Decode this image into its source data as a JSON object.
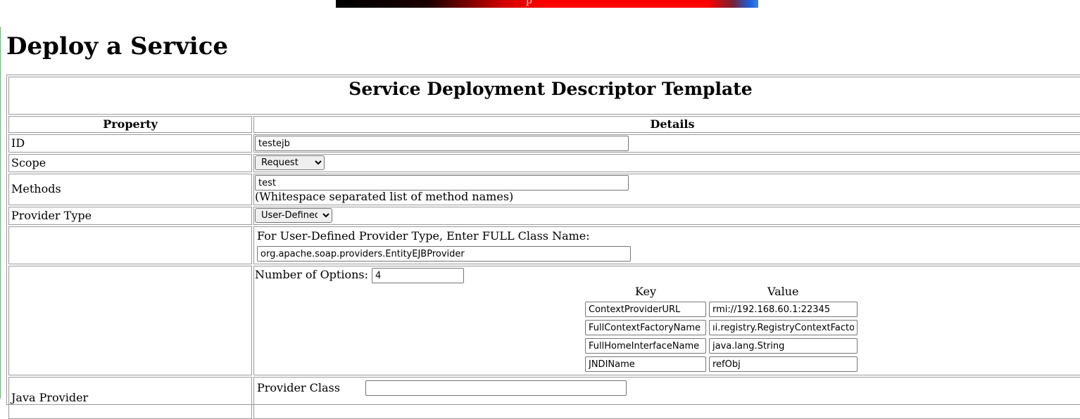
{
  "banner": {
    "glyph": "p"
  },
  "page": {
    "title": "Deploy a Service"
  },
  "form": {
    "table_title": "Service Deployment Descriptor Template",
    "columns": {
      "property": "Property",
      "details": "Details"
    },
    "id": {
      "label": "ID",
      "value": "testejb"
    },
    "scope": {
      "label": "Scope",
      "selected": "Request"
    },
    "methods": {
      "label": "Methods",
      "value": "test",
      "hint": "(Whitespace separated list of method names)"
    },
    "provider_type": {
      "label": "Provider Type",
      "selected": "User-Defined"
    },
    "user_defined": {
      "prompt": "For User-Defined Provider Type, Enter FULL Class Name:",
      "class_name": "org.apache.soap.providers.EntityEJBProvider"
    },
    "options": {
      "count_label": "Number of Options:",
      "count": "4",
      "key_header": "Key",
      "value_header": "Value",
      "rows": [
        {
          "key": "ContextProviderURL",
          "value": "rmi://192.168.60.1:22345"
        },
        {
          "key": "FullContextFactoryName",
          "value": "ıi.registry.RegistryContextFactory"
        },
        {
          "key": "FullHomeInterfaceName",
          "value": "java.lang.String"
        },
        {
          "key": "JNDIName",
          "value": "refObj"
        }
      ]
    },
    "java_provider": {
      "label": "Java Provider",
      "class_label": "Provider Class",
      "class_value": ""
    }
  }
}
